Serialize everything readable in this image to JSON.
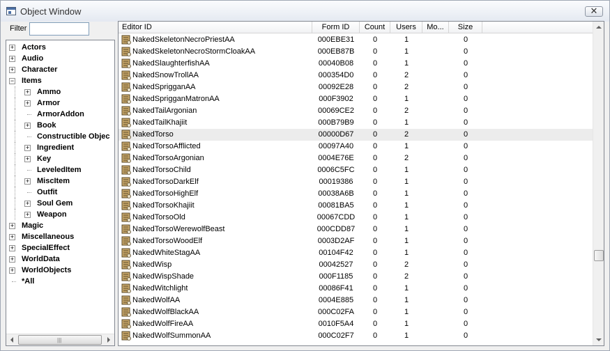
{
  "window": {
    "title": "Object Window",
    "close_label": "✕"
  },
  "filter": {
    "label": "Filter",
    "value": ""
  },
  "tree": {
    "items": [
      {
        "label": "Actors",
        "level": 0,
        "expander": "+"
      },
      {
        "label": "Audio",
        "level": 0,
        "expander": "+"
      },
      {
        "label": "Character",
        "level": 0,
        "expander": "+"
      },
      {
        "label": "Items",
        "level": 0,
        "expander": "-"
      },
      {
        "label": "Ammo",
        "level": 1,
        "expander": "+"
      },
      {
        "label": "Armor",
        "level": 1,
        "expander": "+"
      },
      {
        "label": "ArmorAddon",
        "level": 1,
        "expander": "",
        "selected": true
      },
      {
        "label": "Book",
        "level": 1,
        "expander": "+"
      },
      {
        "label": "Constructible Objec",
        "level": 1,
        "expander": ""
      },
      {
        "label": "Ingredient",
        "level": 1,
        "expander": "+"
      },
      {
        "label": "Key",
        "level": 1,
        "expander": "+"
      },
      {
        "label": "LeveledItem",
        "level": 1,
        "expander": ""
      },
      {
        "label": "MiscItem",
        "level": 1,
        "expander": "+"
      },
      {
        "label": "Outfit",
        "level": 1,
        "expander": ""
      },
      {
        "label": "Soul Gem",
        "level": 1,
        "expander": "+"
      },
      {
        "label": "Weapon",
        "level": 1,
        "expander": "+"
      },
      {
        "label": "Magic",
        "level": 0,
        "expander": "+"
      },
      {
        "label": "Miscellaneous",
        "level": 0,
        "expander": "+"
      },
      {
        "label": "SpecialEffect",
        "level": 0,
        "expander": "+"
      },
      {
        "label": "WorldData",
        "level": 0,
        "expander": "+"
      },
      {
        "label": "WorldObjects",
        "level": 0,
        "expander": "+"
      },
      {
        "label": "*All",
        "level": 0,
        "expander": ""
      }
    ]
  },
  "grid": {
    "columns": {
      "editor_id": "Editor ID",
      "form_id": "Form ID",
      "count": "Count",
      "users": "Users",
      "mo": "Mo...",
      "size": "Size"
    },
    "rows": [
      {
        "editor_id": "NakedSkeletonNecroPriestAA",
        "form_id": "000EBE31",
        "count": "0",
        "users": "1",
        "mo": "",
        "size": "0"
      },
      {
        "editor_id": "NakedSkeletonNecroStormCloakAA",
        "form_id": "000EB87B",
        "count": "0",
        "users": "1",
        "mo": "",
        "size": "0"
      },
      {
        "editor_id": "NakedSlaughterfishAA",
        "form_id": "00040B08",
        "count": "0",
        "users": "1",
        "mo": "",
        "size": "0"
      },
      {
        "editor_id": "NakedSnowTrollAA",
        "form_id": "000354D0",
        "count": "0",
        "users": "2",
        "mo": "",
        "size": "0"
      },
      {
        "editor_id": "NakedSprigganAA",
        "form_id": "00092E28",
        "count": "0",
        "users": "2",
        "mo": "",
        "size": "0"
      },
      {
        "editor_id": "NakedSprigganMatronAA",
        "form_id": "000F3902",
        "count": "0",
        "users": "1",
        "mo": "",
        "size": "0"
      },
      {
        "editor_id": "NakedTailArgonian",
        "form_id": "00069CE2",
        "count": "0",
        "users": "2",
        "mo": "",
        "size": "0"
      },
      {
        "editor_id": "NakedTailKhajiit",
        "form_id": "000B79B9",
        "count": "0",
        "users": "1",
        "mo": "",
        "size": "0"
      },
      {
        "editor_id": "NakedTorso",
        "form_id": "00000D67",
        "count": "0",
        "users": "2",
        "mo": "",
        "size": "0",
        "highlight": true
      },
      {
        "editor_id": "NakedTorsoAfflicted",
        "form_id": "00097A40",
        "count": "0",
        "users": "1",
        "mo": "",
        "size": "0"
      },
      {
        "editor_id": "NakedTorsoArgonian",
        "form_id": "0004E76E",
        "count": "0",
        "users": "2",
        "mo": "",
        "size": "0"
      },
      {
        "editor_id": "NakedTorsoChild",
        "form_id": "0006C5FC",
        "count": "0",
        "users": "1",
        "mo": "",
        "size": "0"
      },
      {
        "editor_id": "NakedTorsoDarkElf",
        "form_id": "00019386",
        "count": "0",
        "users": "1",
        "mo": "",
        "size": "0"
      },
      {
        "editor_id": "NakedTorsoHighElf",
        "form_id": "00038A6B",
        "count": "0",
        "users": "1",
        "mo": "",
        "size": "0"
      },
      {
        "editor_id": "NakedTorsoKhajiit",
        "form_id": "00081BA5",
        "count": "0",
        "users": "1",
        "mo": "",
        "size": "0"
      },
      {
        "editor_id": "NakedTorsoOld",
        "form_id": "00067CDD",
        "count": "0",
        "users": "1",
        "mo": "",
        "size": "0"
      },
      {
        "editor_id": "NakedTorsoWerewolfBeast",
        "form_id": "000CDD87",
        "count": "0",
        "users": "1",
        "mo": "",
        "size": "0"
      },
      {
        "editor_id": "NakedTorsoWoodElf",
        "form_id": "0003D2AF",
        "count": "0",
        "users": "1",
        "mo": "",
        "size": "0"
      },
      {
        "editor_id": "NakedWhiteStagAA",
        "form_id": "00104F42",
        "count": "0",
        "users": "1",
        "mo": "",
        "size": "0"
      },
      {
        "editor_id": "NakedWisp",
        "form_id": "00042527",
        "count": "0",
        "users": "2",
        "mo": "",
        "size": "0"
      },
      {
        "editor_id": "NakedWispShade",
        "form_id": "000F1185",
        "count": "0",
        "users": "2",
        "mo": "",
        "size": "0"
      },
      {
        "editor_id": "NakedWitchlight",
        "form_id": "00086F41",
        "count": "0",
        "users": "1",
        "mo": "",
        "size": "0"
      },
      {
        "editor_id": "NakedWolfAA",
        "form_id": "0004E885",
        "count": "0",
        "users": "1",
        "mo": "",
        "size": "0"
      },
      {
        "editor_id": "NakedWolfBlackAA",
        "form_id": "000C02FA",
        "count": "0",
        "users": "1",
        "mo": "",
        "size": "0"
      },
      {
        "editor_id": "NakedWolfFireAA",
        "form_id": "0010F5A4",
        "count": "0",
        "users": "1",
        "mo": "",
        "size": "0"
      },
      {
        "editor_id": "NakedWolfSummonAA",
        "form_id": "000C02F7",
        "count": "0",
        "users": "1",
        "mo": "",
        "size": "0"
      }
    ]
  },
  "icons": {
    "window": "app-window-icon",
    "row": "armor-addon-icon"
  },
  "colors": {
    "titlebar": "#e4e9f1",
    "row_highlight": "#ececec",
    "border": "#828790"
  }
}
